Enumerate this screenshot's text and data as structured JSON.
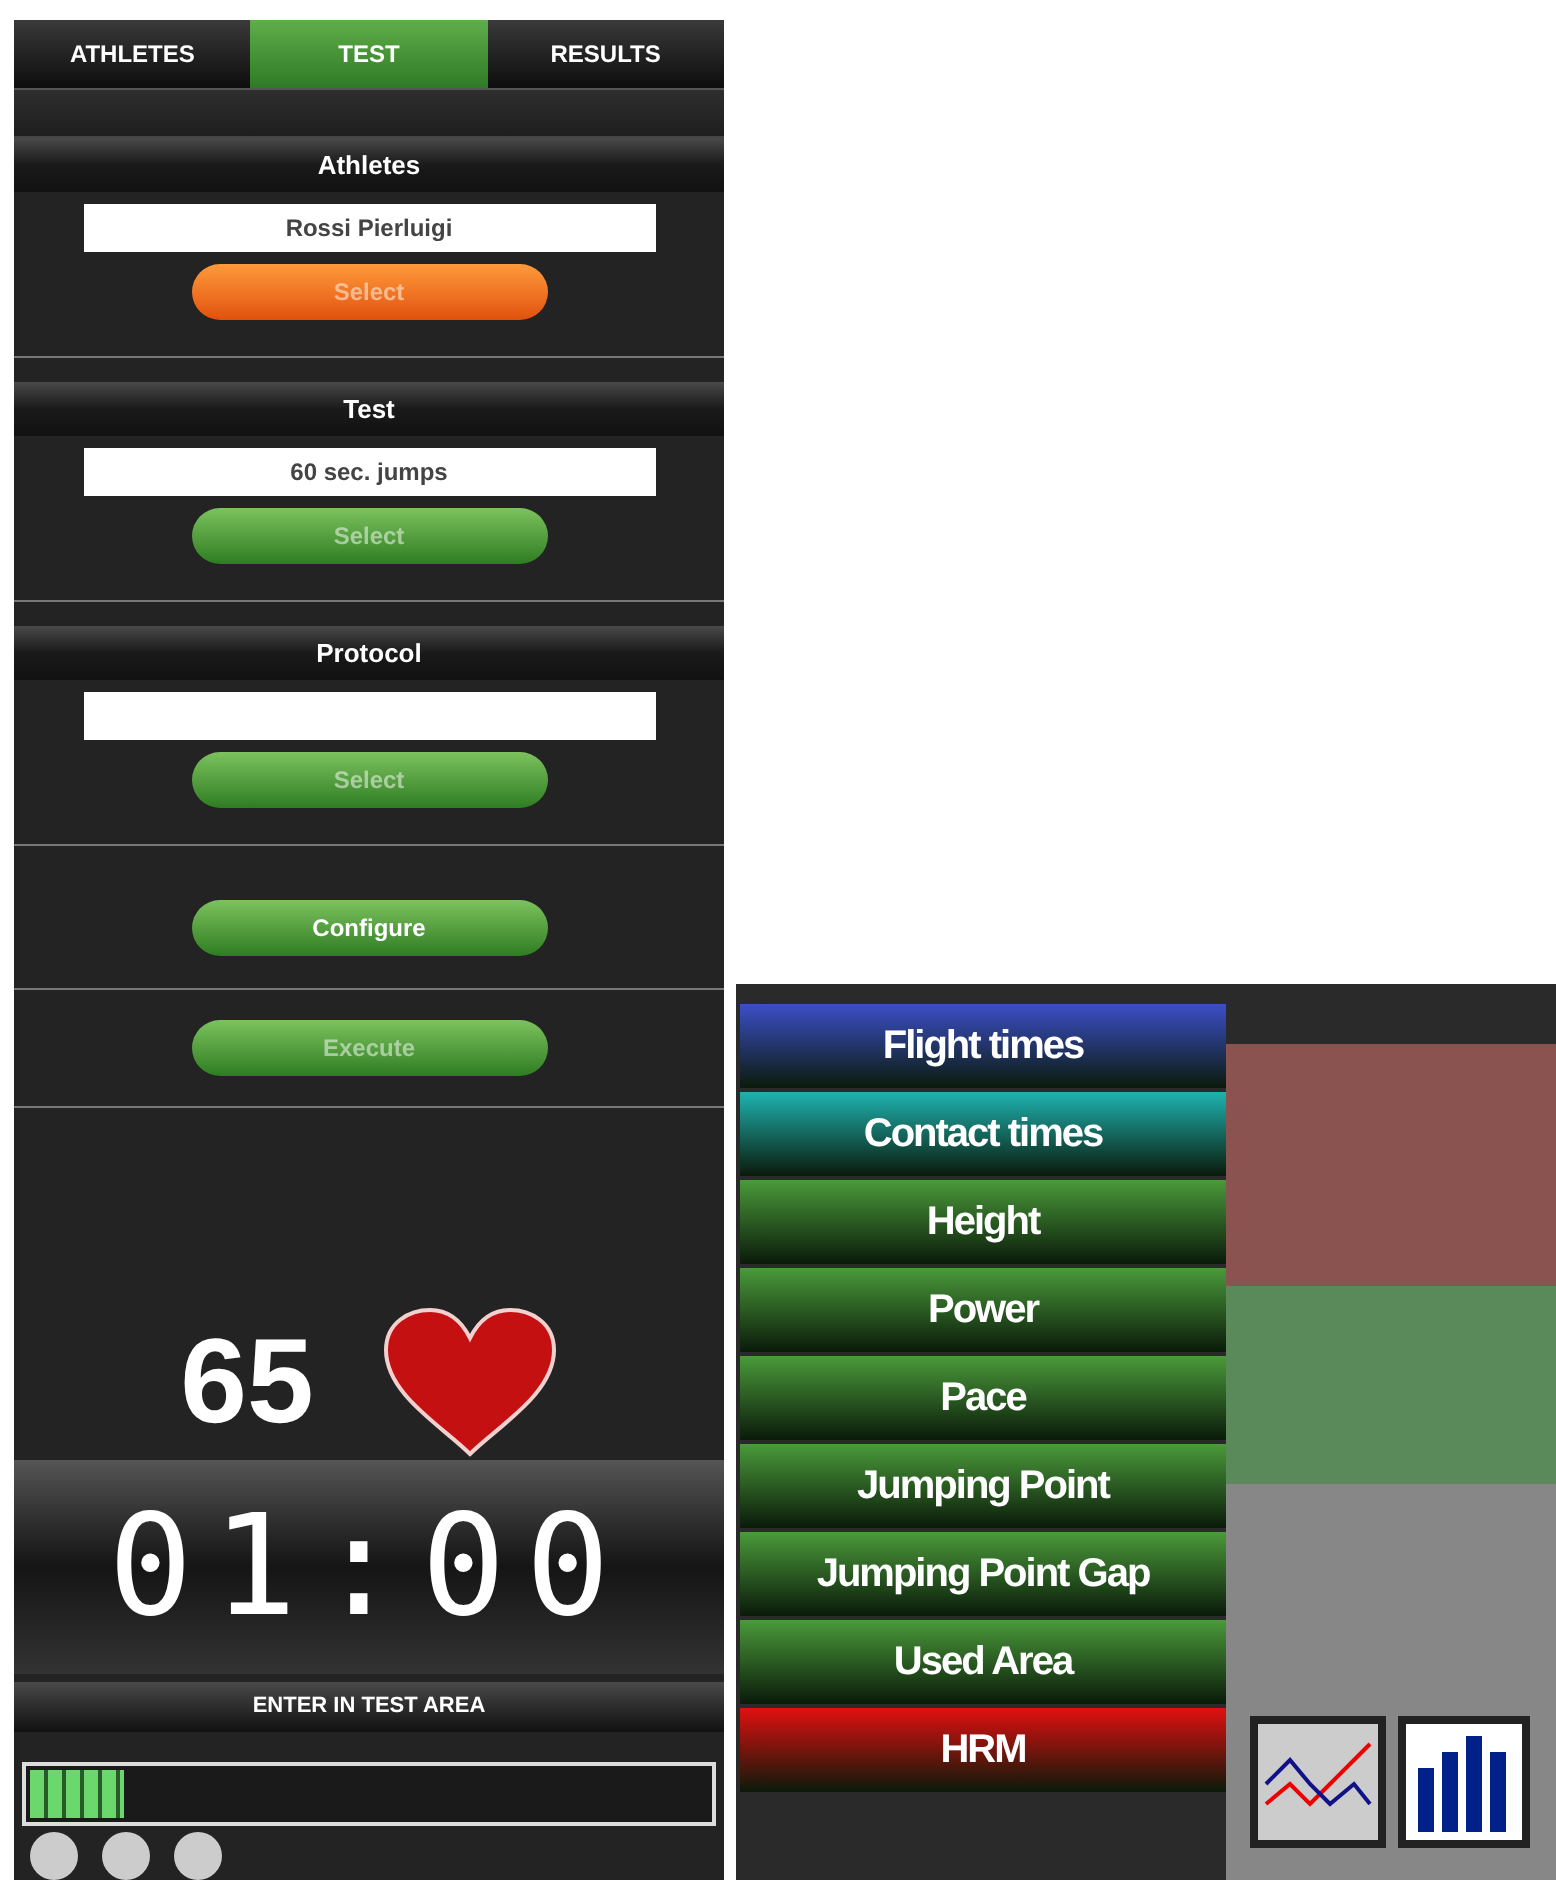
{
  "tabs": [
    {
      "label": "ATHLETES",
      "selected": false
    },
    {
      "label": "TEST",
      "selected": true
    },
    {
      "label": "RESULTS",
      "selected": false
    }
  ],
  "sections": [
    {
      "title": "Athletes",
      "value": "Rossi Pierluigi",
      "button": {
        "label": "Select",
        "highlighted": true,
        "disabled": true
      }
    },
    {
      "title": "Test",
      "value": "60 sec. jumps",
      "button": {
        "label": "Select",
        "highlighted": false,
        "disabled": true
      }
    },
    {
      "title": "Protocol",
      "button": {
        "label": "Select",
        "highlighted": false,
        "disabled": true
      }
    }
  ],
  "actions": [
    {
      "label": "Configure",
      "disabled": false
    },
    {
      "label": "Execute",
      "disabled": true
    }
  ],
  "heart_rate": "65",
  "timer": "01:00",
  "status": "ENTER IN TEST AREA",
  "progress": {
    "level": 0.14
  },
  "metrics": [
    {
      "label": "Flight times",
      "color": "#3b4fc8"
    },
    {
      "label": "Contact times",
      "color": "#1fb3b0"
    },
    {
      "label": "Height",
      "color": "#4a9a3a"
    },
    {
      "label": "Power",
      "color": "#4a9a3a"
    },
    {
      "label": "Pace",
      "color": "#4a9a3a"
    },
    {
      "label": "Jumping Point",
      "color": "#4a9a3a"
    },
    {
      "label": "Jumping Point Gap",
      "color": "#4a9a3a"
    },
    {
      "label": "Used Area",
      "color": "#4a9a3a"
    },
    {
      "label": "HRM",
      "color": "#e01010"
    }
  ],
  "zones": [
    {
      "color": "#8a5350"
    },
    {
      "color": "#5a8a5a"
    },
    {
      "color": "#878787"
    }
  ]
}
